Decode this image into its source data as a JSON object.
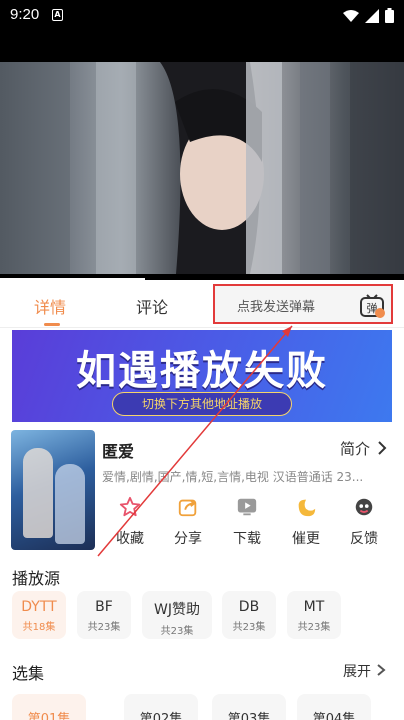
{
  "status_bar": {
    "time": "9:20",
    "notification_letter": "A"
  },
  "tabs": {
    "detail": "详情",
    "comment": "评论"
  },
  "danmaku": {
    "placeholder": "点我发送弹幕",
    "icon_text": "弹"
  },
  "banner": {
    "title": "如遇播放失败",
    "subtitle": "切换下方其他地址播放"
  },
  "show": {
    "title": "匿爱",
    "intro_label": "简介",
    "tags": "爱情,剧情,国产,情,短,言情,电视 汉语普通话 23..."
  },
  "actions": [
    {
      "label": "收藏",
      "icon": "star-icon",
      "color": "#e8536b"
    },
    {
      "label": "分享",
      "icon": "share-icon",
      "color": "#f0a13a"
    },
    {
      "label": "下载",
      "icon": "download-icon",
      "color": "#8a8a8a"
    },
    {
      "label": "催更",
      "icon": "urge-update-icon",
      "color": "#f5b83a"
    },
    {
      "label": "反馈",
      "icon": "feedback-icon",
      "color": "#444444"
    }
  ],
  "sources": {
    "title": "播放源",
    "items": [
      {
        "name": "DYTT",
        "count": "共18集"
      },
      {
        "name": "BF",
        "count": "共23集"
      },
      {
        "name": "WJ赞助",
        "count": "共23集"
      },
      {
        "name": "DB",
        "count": "共23集"
      },
      {
        "name": "MT",
        "count": "共23集"
      }
    ]
  },
  "episodes": {
    "title": "选集",
    "expand_label": "展开",
    "items": [
      "第01集",
      "第02集",
      "第03集",
      "第04集"
    ]
  },
  "accent_color": "#f08c4d",
  "annotation_color": "#e23a3a"
}
